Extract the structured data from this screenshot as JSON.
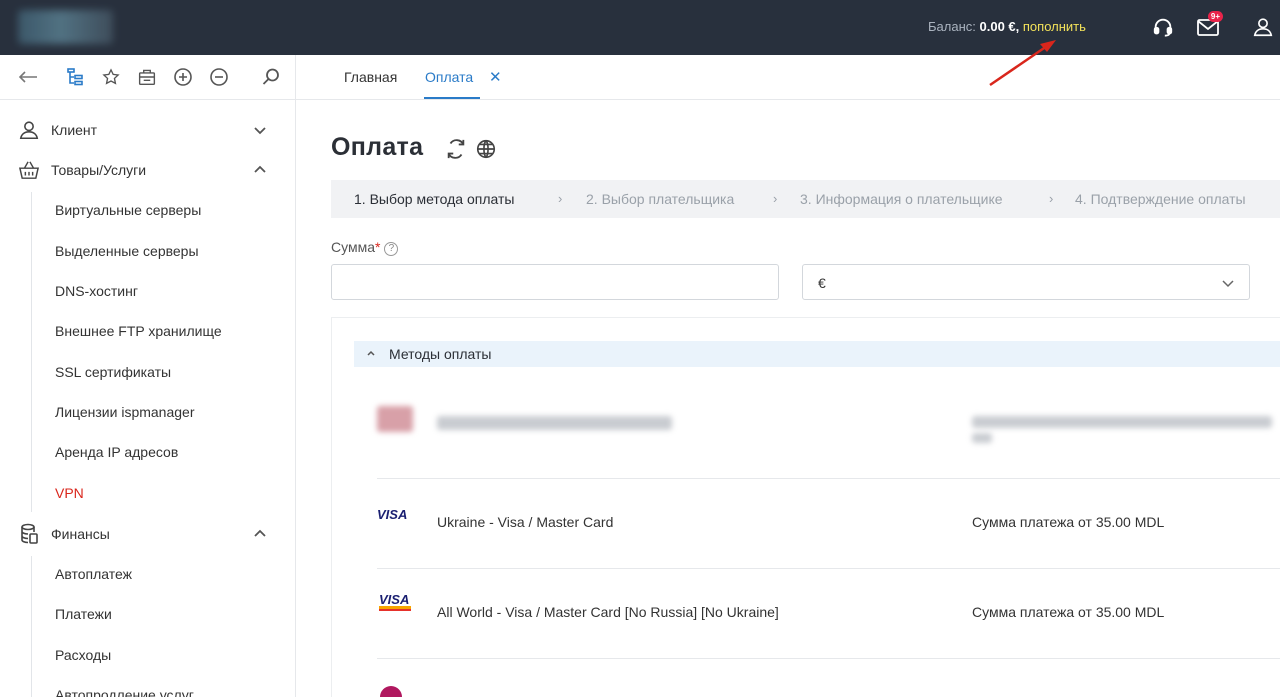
{
  "topbar": {
    "balance_label": "Баланс:",
    "balance_amount": "0.00 €,",
    "topup_link": "пополнить",
    "notifications_badge": "9+"
  },
  "tabs": [
    {
      "label": "Главная"
    },
    {
      "label": "Оплата",
      "close": "✕"
    }
  ],
  "sidebar": {
    "sections": [
      {
        "label": "Клиент"
      },
      {
        "label": "Товары/Услуги",
        "items": [
          "Виртуальные серверы",
          "Выделенные серверы",
          "DNS-хостинг",
          "Внешнее FTP хранилище",
          "SSL сертификаты",
          "Лицензии ispmanager",
          "Аренда IP адресов",
          "VPN"
        ]
      },
      {
        "label": "Финансы",
        "items": [
          "Автоплатеж",
          "Платежи",
          "Расходы",
          "Автопродление услуг"
        ]
      }
    ]
  },
  "main": {
    "title": "Оплата",
    "steps": [
      "1. Выбор метода оплаты",
      "2. Выбор плательщика",
      "3. Информация о плательщике",
      "4. Подтверждение оплаты"
    ],
    "amount_label": "Сумма",
    "amount_required": "*",
    "help_glyph": "?",
    "amount_value": "",
    "currency_value": "€",
    "methods_header": "Методы оплаты",
    "methods": [
      {
        "name": "Ukraine - Visa / Master Card",
        "min": "Сумма платежа от 35.00 MDL",
        "logo": "visa-logo"
      },
      {
        "name": "All World - Visa / Master Card [No Russia] [No Ukraine]",
        "min": "Сумма платежа от 35.00 MDL",
        "logo": "visa-mastercard-logo"
      }
    ]
  },
  "colors": {
    "topbar_bg": "#28303d",
    "accent": "#2a7bc8",
    "topup_link": "#f3e25a",
    "active_vpn": "#d9261c",
    "annotation_arrow": "#d9261c"
  }
}
